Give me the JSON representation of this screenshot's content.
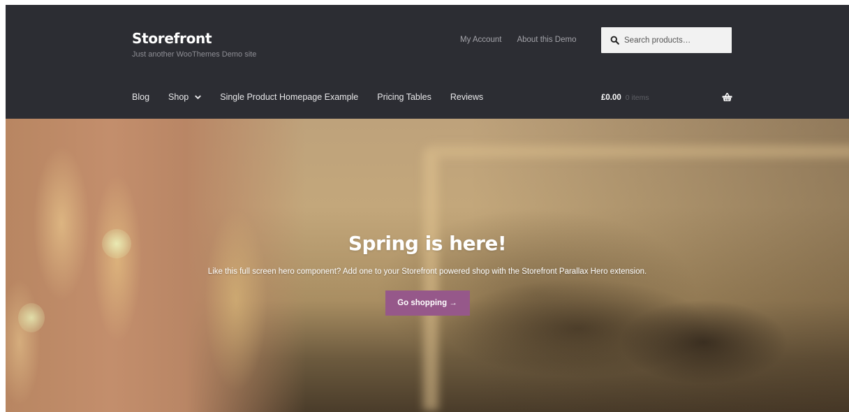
{
  "header": {
    "site_title": "Storefront",
    "tagline": "Just another WooThemes Demo site",
    "background": "#2c2d33",
    "secondary_nav": [
      "My Account",
      "About this Demo"
    ],
    "search": {
      "placeholder": "Search products…",
      "value": "",
      "icon": "search-icon"
    },
    "primary_nav": [
      "Blog",
      "Shop",
      "Single Product Homepage Example",
      "Pricing Tables",
      "Reviews"
    ],
    "shop_icon": "chevron-down-icon",
    "cart": {
      "amount": "£0.00",
      "count": "0 items",
      "icon": "basket-icon"
    }
  },
  "hero": {
    "heading": "Spring is here!",
    "text": "Like this full screen hero component? Add one to your Storefront powered shop with the Storefront Parallax Hero extension.",
    "button_label": "Go shopping →",
    "button_color": "#96588a"
  }
}
